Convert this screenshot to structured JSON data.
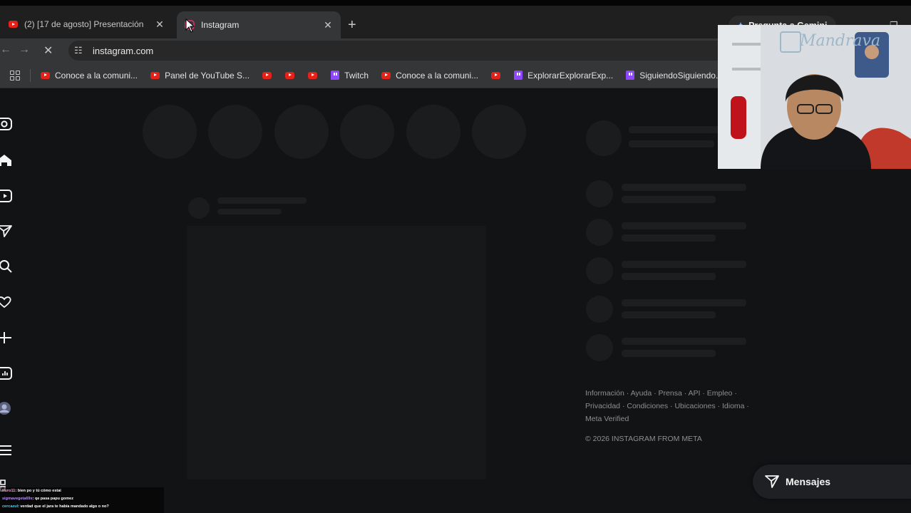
{
  "tabs": [
    {
      "title": "(2) [17 de agosto] Presentación",
      "favicon": "youtube-icon",
      "active": false
    },
    {
      "title": "Instagram",
      "favicon": "instagram-icon",
      "active": true
    }
  ],
  "gemini_label": "Pregunta a Gemini",
  "address": "instagram.com",
  "bookmarks": [
    {
      "label": "Conoce a la comuni...",
      "icon": "youtube-icon"
    },
    {
      "label": "Panel de YouTube S...",
      "icon": "youtube-icon"
    },
    {
      "label": "",
      "icon": "youtube-icon"
    },
    {
      "label": "",
      "icon": "youtube-icon"
    },
    {
      "label": "",
      "icon": "youtube-icon"
    },
    {
      "label": "Twitch",
      "icon": "twitch-icon"
    },
    {
      "label": "Conoce a la comuni...",
      "icon": "youtube-icon"
    },
    {
      "label": "",
      "icon": "youtube-icon"
    },
    {
      "label": "ExplorarExplorarExp...",
      "icon": "twitch-icon"
    },
    {
      "label": "SiguiendoSiguiendo...",
      "icon": "twitch-icon"
    }
  ],
  "footer": {
    "line1": "Información · Ayuda · Prensa · API · Empleo ·",
    "line2": "Privacidad · Condiciones · Ubicaciones · Idioma ·",
    "line3": "Meta Verified",
    "copyright": "© 2026 INSTAGRAM FROM META"
  },
  "messages_label": "Mensajes",
  "webcam": {
    "title": "Mandrava"
  },
  "chat": [
    {
      "user": "Puro11",
      "text": ": bien po y tú cómo estai"
    },
    {
      "user": "sigmavegeta69x",
      "text": ": qe pasa papu gomez"
    },
    {
      "user": "cercazul",
      "text": ": verdad que el jara te había mandado algo o no?"
    }
  ],
  "colors": {
    "youtube": "#e62117",
    "twitch": "#9146ff",
    "background": "#121315"
  }
}
